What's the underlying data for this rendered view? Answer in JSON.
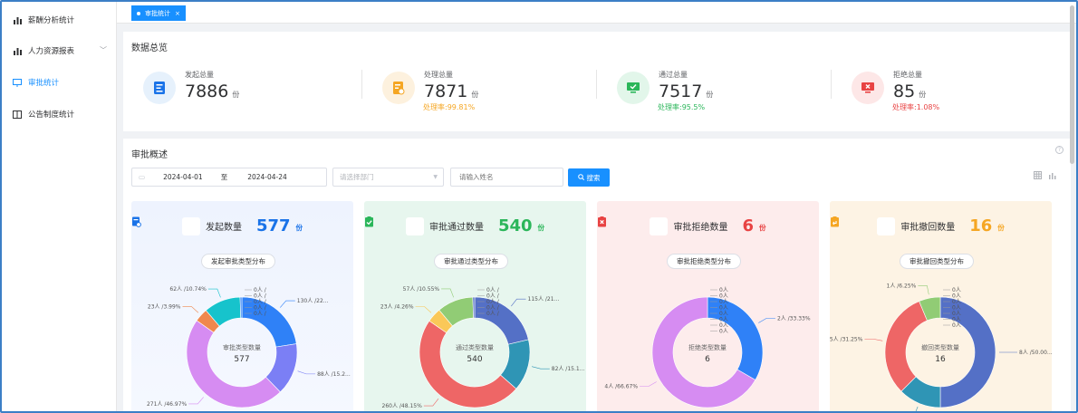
{
  "sidebar": {
    "items": [
      {
        "label": "薪酬分析统计",
        "icon": "bar-chart-icon"
      },
      {
        "label": "人力资源报表",
        "icon": "bar-chart-icon"
      },
      {
        "label": "审批统计",
        "icon": "monitor-icon",
        "active": true
      },
      {
        "label": "公告制度统计",
        "icon": "book-icon"
      }
    ]
  },
  "tabs": [
    {
      "label": "审批统计",
      "active": true
    }
  ],
  "overview": {
    "title": "数据总览",
    "stats": [
      {
        "label": "发起总量",
        "value": "7886",
        "unit": "份",
        "color": "#1a73e8"
      },
      {
        "label": "处理总量",
        "value": "7871",
        "unit": "份",
        "rate": "处理率:99.81%",
        "color": "#f5a623"
      },
      {
        "label": "通过总量",
        "value": "7517",
        "unit": "份",
        "rate": "处理率:95.5%",
        "color": "#2bb65a"
      },
      {
        "label": "拒绝总量",
        "value": "85",
        "unit": "份",
        "rate": "处理率:1.08%",
        "color": "#e84343"
      }
    ]
  },
  "summary": {
    "title": "审批概述",
    "filters": {
      "start_date": "2024-04-01",
      "range_sep": "至",
      "end_date": "2024-04-24",
      "dept_placeholder": "请选择部门",
      "name_placeholder": "请输入姓名",
      "search_label": "搜索"
    }
  },
  "panels": [
    {
      "title": "发起数量",
      "count": "577",
      "unit": "份",
      "dist_label": "发起审批类型分布",
      "color": "#1a73e8"
    },
    {
      "title": "审批通过数量",
      "count": "540",
      "unit": "份",
      "dist_label": "审批通过类型分布",
      "color": "#2bb65a"
    },
    {
      "title": "审批拒绝数量",
      "count": "6",
      "unit": "份",
      "dist_label": "审批拒绝类型分布",
      "color": "#e84343"
    },
    {
      "title": "审批撤回数量",
      "count": "16",
      "unit": "份",
      "dist_label": "审批撤回类型分布",
      "color": "#f5a623"
    }
  ],
  "chart_data": [
    {
      "type": "pie",
      "center_title": "审批类型数量",
      "center_value": "577",
      "slices": [
        {
          "value": 130,
          "label": "130人 /22...",
          "color": "#2f81f7"
        },
        {
          "value": 88,
          "label": "88人 /15.2...",
          "color": "#7b7ff5"
        },
        {
          "value": 271,
          "label": "271人 /46.97%",
          "color": "#d68cf2"
        },
        {
          "value": 23,
          "label": "23人 /3.99%",
          "color": "#f0884d"
        },
        {
          "value": 62,
          "label": "62人 /10.74%",
          "color": "#17c3cc"
        },
        {
          "value": 3,
          "label": "3人 /0.52%",
          "color": "#2f81f7"
        }
      ],
      "zero_labels": [
        "0人 /",
        "0人 /",
        "0人 /",
        "0人 /",
        "0人 /"
      ]
    },
    {
      "type": "pie",
      "center_title": "通过类型数量",
      "center_value": "540",
      "slices": [
        {
          "value": 115,
          "label": "115人 /21...",
          "color": "#5470c6"
        },
        {
          "value": 82,
          "label": "82人 /15.1...",
          "color": "#2f95b5"
        },
        {
          "value": 260,
          "label": "260人 /48.15%",
          "color": "#ee6666"
        },
        {
          "value": 23,
          "label": "23人 /4.26%",
          "color": "#fac858"
        },
        {
          "value": 57,
          "label": "57人 /10.55%",
          "color": "#91cc75"
        },
        {
          "value": 3,
          "label": "3人 /0.56%",
          "color": "#5470c6"
        }
      ],
      "zero_labels": [
        "0人 /",
        "0人 /",
        "0人 /",
        "0人 /",
        "0人 /"
      ]
    },
    {
      "type": "pie",
      "center_title": "拒绝类型数量",
      "center_value": "6",
      "slices": [
        {
          "value": 2,
          "label": "2人 /33.33%",
          "color": "#2f81f7"
        },
        {
          "value": 4,
          "label": "4人 /66.67%",
          "color": "#d68cf2"
        }
      ],
      "zero_labels": [
        "0人",
        "0人",
        "0人",
        "0人",
        "0人",
        "0人",
        "0人",
        "0人"
      ]
    },
    {
      "type": "pie",
      "center_title": "撤回类型数量",
      "center_value": "16",
      "slices": [
        {
          "value": 8,
          "label": "8人 /50.00...",
          "color": "#5470c6"
        },
        {
          "value": 2,
          "label": "2人 /12.50%",
          "color": "#2f95b5"
        },
        {
          "value": 5,
          "label": "5人 /31.25%",
          "color": "#ee6666"
        },
        {
          "value": 1,
          "label": "1人 /6.25%",
          "color": "#91cc75"
        }
      ],
      "zero_labels": [
        "0人",
        "0人",
        "0人",
        "0人",
        "0人",
        "0人",
        "0人"
      ]
    }
  ]
}
